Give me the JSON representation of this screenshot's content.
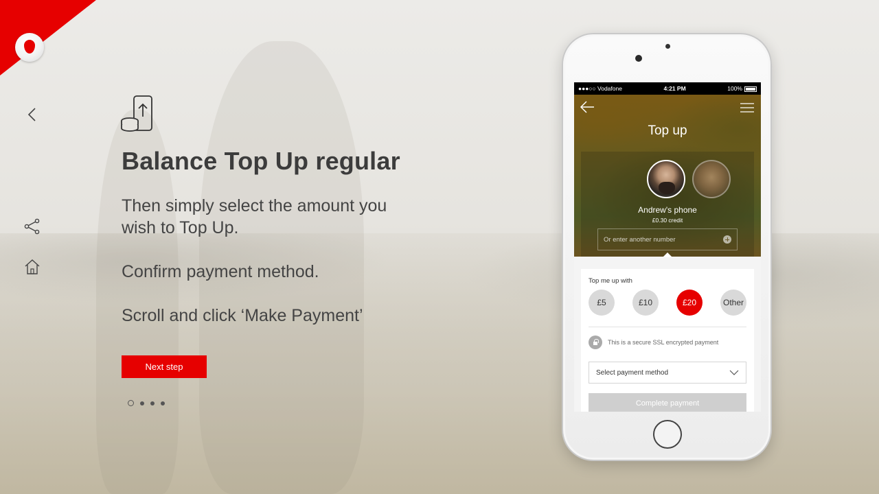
{
  "brand": {
    "accent": "#e60000",
    "logo_icon": "vodafone-speechmark-icon"
  },
  "rail": {
    "icons": [
      "chevron-left-icon",
      "share-icon",
      "home-icon"
    ]
  },
  "hero": {
    "icon": "phone-topup-coins-icon",
    "title": "Balance Top Up regular",
    "steps": [
      "Then simply select the amount you wish to Top Up.",
      "Confirm payment method.",
      "Scroll and click ‘Make Payment’"
    ],
    "next_label": "Next step",
    "pagination": {
      "total": 4,
      "current": 1
    }
  },
  "phone": {
    "status": {
      "carrier": "●●●○○ Vodafone",
      "time": "4:21 PM",
      "battery": "100%"
    },
    "app": {
      "title": "Top up",
      "contact_name": "Andrew's phone",
      "contact_credit": "£0.30 credit",
      "number_placeholder": "Or enter another number",
      "topup_label": "Top me up with",
      "amounts": [
        "£5",
        "£10",
        "£20",
        "Other"
      ],
      "selected_amount": "£20",
      "secure_text": "This is a secure SSL encrypted payment",
      "payment_select": "Select payment method",
      "complete_label": "Complete payment"
    }
  }
}
